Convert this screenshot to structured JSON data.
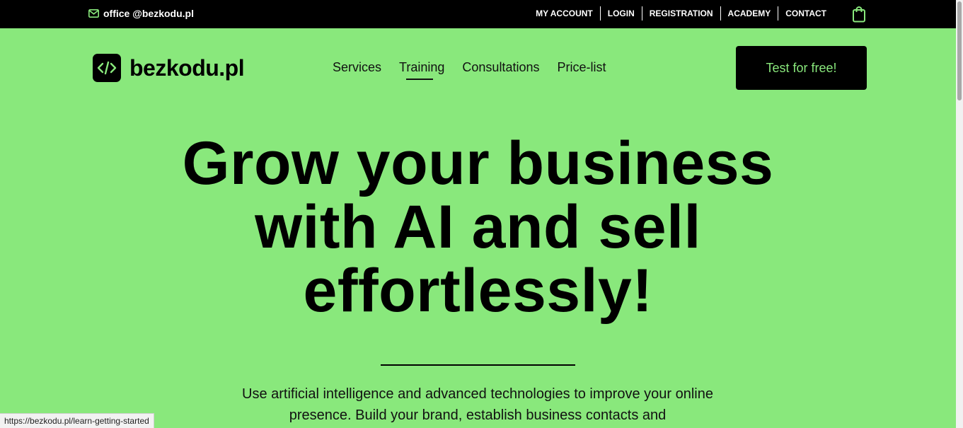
{
  "topbar": {
    "email": "office @bezkodu.pl",
    "links": [
      "MY ACCOUNT",
      "LOGIN",
      "REGISTRATION",
      "ACADEMY",
      "CONTACT"
    ],
    "icons": {
      "email": "mail-icon",
      "cart": "shopping-bag-icon"
    }
  },
  "header": {
    "logo_text": "bezkodu.pl",
    "logo_icon": "code-brackets-icon",
    "nav": [
      "Services",
      "Training",
      "Consultations",
      "Price-list"
    ],
    "active_nav": "Training",
    "cta_label": "Test for free!"
  },
  "hero": {
    "title_lines": [
      "Grow your business",
      "with AI and sell",
      "effortlessly!"
    ],
    "description": "Use artificial intelligence and advanced technologies to improve your online presence.  Build your brand, establish business contacts and"
  },
  "status_url": "https://bezkodu.pl/learn-getting-started",
  "colors": {
    "background": "#89e87c",
    "topbar": "#000000",
    "cta_bg": "#000000",
    "cta_text": "#89e87c"
  }
}
